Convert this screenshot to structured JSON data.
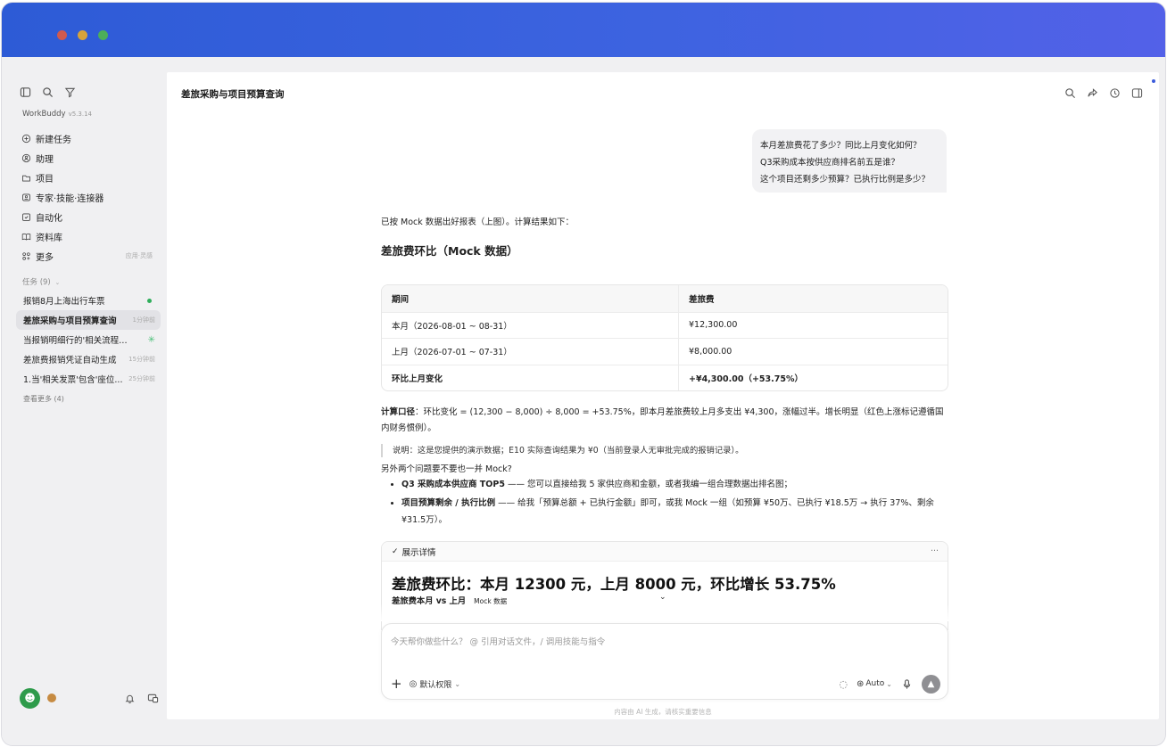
{
  "window": {
    "controls": [
      "close",
      "minimize",
      "zoom"
    ]
  },
  "sidebar": {
    "brand": "WorkBuddy",
    "version": "v5.3.14",
    "nav": [
      {
        "label": "新建任务",
        "icon": "plus-circle-icon"
      },
      {
        "label": "助理",
        "icon": "assistant-icon"
      },
      {
        "label": "项目",
        "icon": "project-icon"
      },
      {
        "label": "专家·技能·连接器",
        "icon": "expert-icon"
      },
      {
        "label": "自动化",
        "icon": "automation-icon"
      },
      {
        "label": "资料库",
        "icon": "book-icon"
      },
      {
        "label": "更多",
        "icon": "more-grid-icon",
        "extra": "应用·灵感"
      }
    ],
    "tasks_header": "任务 (9)",
    "tasks": [
      {
        "label": "报销8月上海出行车票",
        "status": "done"
      },
      {
        "label": "差旅采购与项目预算查询",
        "time": "1分钟前",
        "active": true
      },
      {
        "label": "当报销明细行的'相关流程事...",
        "status": "running"
      },
      {
        "label": "差旅费报销凭证自动生成",
        "time": "15分钟前"
      },
      {
        "label": "1.当'相关发票'包含'座位...",
        "time": "25分钟前"
      }
    ],
    "see_more": "查看更多 (4)"
  },
  "main": {
    "title": "差旅采购与项目预算查询",
    "user_message": [
      "本月差旅费花了多少？同比上月变化如何？",
      "Q3采购成本按供应商排名前五是谁？",
      "这个项目还剩多少预算？已执行比例是多少？"
    ],
    "reply_intro": "已按 Mock 数据出好报表（上图）。计算结果如下：",
    "section_title": "差旅费环比（Mock 数据）",
    "table": {
      "headers": [
        "期间",
        "差旅费"
      ],
      "rows": [
        [
          "本月（2026-08-01 ~ 08-31）",
          "¥12,300.00"
        ],
        [
          "上月（2026-07-01 ~ 07-31）",
          "¥8,000.00"
        ],
        [
          "环比上月变化",
          "+¥4,300.00（+53.75%）"
        ]
      ]
    },
    "calc_label": "计算口径",
    "calc_text": "：环比变化 = (12,300 − 8,000) ÷ 8,000 = +53.75%，即本月差旅费较上月多支出 ¥4,300，涨幅过半。增长明显（红色上涨标记遵循国内财务惯例）。",
    "quote": "说明：这是您提供的演示数据；E10 实际查询结果为 ¥0（当前登录人无审批完成的报销记录）。",
    "other_question": "另外两个问题要不要也一并 Mock?",
    "bullets": [
      {
        "bold": "Q3 采购成本供应商 TOP5",
        "text": " —— 您可以直接给我 5 家供应商和金额，或者我编一组合理数据出排名图；"
      },
      {
        "bold": "项目预算剩余 / 执行比例",
        "text": " —— 给我「预算总额 + 已执行金额」即可，或我 Mock 一组（如预算 ¥50万、已执行 ¥18.5万 → 执行 37%、剩余 ¥31.5万）。"
      }
    ],
    "card": {
      "toggle": "展示详情",
      "more": "···",
      "title": "差旅费环比：本月 12300 元，上月 8000 元，环比增长 53.75%",
      "subtitle": "差旅费本月 vs 上月",
      "tag": "Mock 数据"
    },
    "composer": {
      "placeholder": "今天帮你做些什么？ @ 引用对话文件，/ 调用技能与指令",
      "permission": "默认权限",
      "model": "Auto"
    },
    "footer": "内容由 AI 生成，请核实重要信息"
  }
}
